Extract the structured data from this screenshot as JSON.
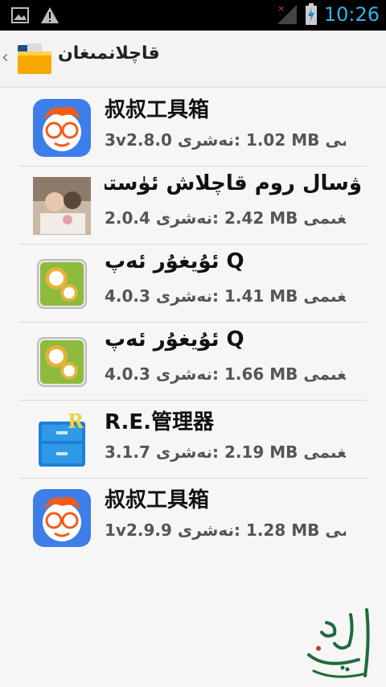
{
  "status_bar": {
    "time": "10:26",
    "icons": [
      "image-icon",
      "warning-icon",
      "no-signal-icon",
      "battery-charging-icon"
    ]
  },
  "action_bar": {
    "title": "قاچلانمىغان",
    "icon": "folder-icon"
  },
  "items": [
    {
      "name": "叔叔工具箱",
      "size_label": "سىغىمى:",
      "size": "1.02 MB",
      "version_label": "نەشرى:",
      "version": "3v2.8.0",
      "icon": "uncle-toolbox-icon"
    },
    {
      "name": "ۋسال روم قاچلاش ئۈستىسى",
      "size_label": "سىغىمى:",
      "size": "2.42 MB",
      "version_label": "نەشرى:",
      "version": "2.0.4",
      "icon": "photo-couple-icon"
    },
    {
      "name": "ئۇيغۇر ئەپ Q",
      "size_label": "سىغىمى:",
      "size": "1.41 MB",
      "version_label": "نەشرى:",
      "version": "4.0.3",
      "icon": "uyghur-app-gear-icon"
    },
    {
      "name": "ئۇيغۇر ئەپ Q",
      "size_label": "سىغىمى:",
      "size": "1.66 MB",
      "version_label": "نەشرى:",
      "version": "4.0.3",
      "icon": "uyghur-app-gear-icon"
    },
    {
      "name": "R.E.管理器",
      "size_label": "سىغىمى:",
      "size": "2.19 MB",
      "version_label": "نەشرى:",
      "version": "3.1.7",
      "icon": "re-manager-icon"
    },
    {
      "name": "叔叔工具箱",
      "size_label": "سىغىمى:",
      "size": "1.28 MB",
      "version_label": "نەشرى:",
      "version": "1v2.9.9",
      "icon": "uncle-toolbox-icon"
    }
  ],
  "watermark": "ئالىتۇرى"
}
